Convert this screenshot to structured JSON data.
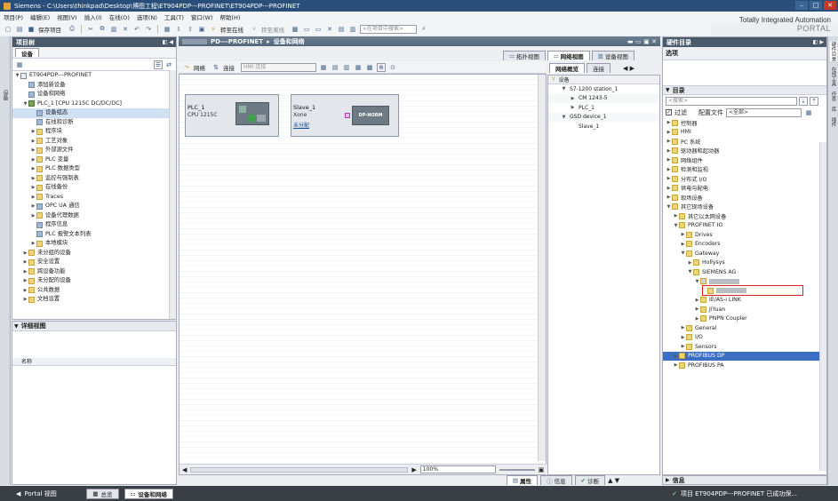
{
  "window": {
    "title": "Siemens  -  C:\\Users\\thinkpad\\Desktop\\博图工程\\ET904PDP---PROFINET\\ET904PDP---PROFINET"
  },
  "brand": {
    "line1": "Totally Integrated Automation",
    "line2": "PORTAL"
  },
  "menu": [
    "项目(P)",
    "编辑(E)",
    "视图(V)",
    "插入(I)",
    "在线(O)",
    "选项(N)",
    "工具(T)",
    "窗口(W)",
    "帮助(H)"
  ],
  "toolbar": {
    "save_label": "保存项目",
    "go_online_label": "转至在线",
    "go_offline_label": "转至离线",
    "search_placeholder": "<在项目中搜索>"
  },
  "project_tree": {
    "header": "项目树",
    "devices_tab": "设备",
    "rows": [
      {
        "indent": 0,
        "twisty": "▼",
        "icon": "doc",
        "label": "ET904PDP---PROFINET"
      },
      {
        "indent": 1,
        "twisty": "",
        "icon": "cfg",
        "label": "添加新设备"
      },
      {
        "indent": 1,
        "twisty": "",
        "icon": "cfg",
        "label": "设备和网络"
      },
      {
        "indent": 1,
        "twisty": "▼",
        "icon": "plc",
        "label": "PLC_1 [CPU 1215C DC/DC/DC]"
      },
      {
        "indent": 2,
        "twisty": "",
        "icon": "cfg",
        "label": "设备组态",
        "selected": true
      },
      {
        "indent": 2,
        "twisty": "",
        "icon": "cfg",
        "label": "在线和诊断"
      },
      {
        "indent": 2,
        "twisty": "▶",
        "icon": "folder",
        "label": "程序块"
      },
      {
        "indent": 2,
        "twisty": "▶",
        "icon": "folder",
        "label": "工艺对象"
      },
      {
        "indent": 2,
        "twisty": "▶",
        "icon": "folder",
        "label": "外部源文件"
      },
      {
        "indent": 2,
        "twisty": "▶",
        "icon": "folder",
        "label": "PLC 变量"
      },
      {
        "indent": 2,
        "twisty": "▶",
        "icon": "folder",
        "label": "PLC 数据类型"
      },
      {
        "indent": 2,
        "twisty": "▶",
        "icon": "folder",
        "label": "监控与强制表"
      },
      {
        "indent": 2,
        "twisty": "▶",
        "icon": "folder",
        "label": "在线备份"
      },
      {
        "indent": 2,
        "twisty": "▶",
        "icon": "folder",
        "label": "Traces"
      },
      {
        "indent": 2,
        "twisty": "▶",
        "icon": "cfg",
        "label": "OPC UA 通信"
      },
      {
        "indent": 2,
        "twisty": "▶",
        "icon": "folder",
        "label": "设备代理数据"
      },
      {
        "indent": 2,
        "twisty": "",
        "icon": "cfg",
        "label": "程序信息"
      },
      {
        "indent": 2,
        "twisty": "",
        "icon": "cfg",
        "label": "PLC 报警文本列表"
      },
      {
        "indent": 2,
        "twisty": "▶",
        "icon": "folder",
        "label": "本地模块"
      },
      {
        "indent": 1,
        "twisty": "▶",
        "icon": "folder",
        "label": "未分组的设备"
      },
      {
        "indent": 1,
        "twisty": "▶",
        "icon": "folder",
        "label": "安全设置"
      },
      {
        "indent": 1,
        "twisty": "▶",
        "icon": "folder",
        "label": "跨设备功能"
      },
      {
        "indent": 1,
        "twisty": "▶",
        "icon": "folder",
        "label": "未分配的设备"
      },
      {
        "indent": 1,
        "twisty": "▶",
        "icon": "folder",
        "label": "公共数据"
      },
      {
        "indent": 1,
        "twisty": "▶",
        "icon": "folder",
        "label": "文档设置"
      }
    ],
    "details_header": "详细视图",
    "details_col": "名称"
  },
  "center": {
    "breadcrumb_a": "PD---PROFINET",
    "breadcrumb_b": "设备和网络",
    "tabs": [
      "拓扑视图",
      "网络视图",
      "设备视图"
    ],
    "tool_network": "网络",
    "tool_connect": "连接",
    "hmi_dropdown": "HMI 连接",
    "devices": [
      {
        "name": "PLC_1",
        "type": "CPU 1215C",
        "link": ""
      },
      {
        "name": "Slave_1",
        "type": "Xone",
        "link": "未分配",
        "module": "DP-NORM"
      }
    ],
    "zoom": "100%"
  },
  "network_overview": {
    "tabs": [
      "网络概览",
      "连接"
    ],
    "col": "设备",
    "rows": [
      {
        "indent": 1,
        "twisty": "▼",
        "label": "S7-1200 station_1"
      },
      {
        "indent": 2,
        "twisty": "▶",
        "label": "CM 1243-5"
      },
      {
        "indent": 2,
        "twisty": "▶",
        "label": "PLC_1"
      },
      {
        "indent": 1,
        "twisty": "▼",
        "label": "GSD device_1"
      },
      {
        "indent": 2,
        "twisty": "",
        "label": "Slave_1"
      }
    ]
  },
  "hw_catalog": {
    "header": "硬件目录",
    "options": "选项",
    "catalog": "目录",
    "search_placeholder": "<搜索>",
    "filter_label": "过滤",
    "profile_label": "配置文件",
    "profile_value": "<全部>",
    "rows": [
      {
        "indent": 0,
        "twisty": "▶",
        "label": "控制器"
      },
      {
        "indent": 0,
        "twisty": "▶",
        "label": "HMI"
      },
      {
        "indent": 0,
        "twisty": "▶",
        "label": "PC 系统"
      },
      {
        "indent": 0,
        "twisty": "▶",
        "label": "驱动器和起动器"
      },
      {
        "indent": 0,
        "twisty": "▶",
        "label": "网络组件"
      },
      {
        "indent": 0,
        "twisty": "▶",
        "label": "检测和监视"
      },
      {
        "indent": 0,
        "twisty": "▶",
        "label": "分布式 I/O"
      },
      {
        "indent": 0,
        "twisty": "▶",
        "label": "供电与配电"
      },
      {
        "indent": 0,
        "twisty": "▶",
        "label": "现场设备"
      },
      {
        "indent": 0,
        "twisty": "▼",
        "label": "其它现场设备"
      },
      {
        "indent": 1,
        "twisty": "▶",
        "label": "其它以太网设备"
      },
      {
        "indent": 1,
        "twisty": "▼",
        "label": "PROFINET IO"
      },
      {
        "indent": 2,
        "twisty": "▶",
        "label": "Drives"
      },
      {
        "indent": 2,
        "twisty": "▶",
        "label": "Encoders"
      },
      {
        "indent": 2,
        "twisty": "▼",
        "label": "Gateway"
      },
      {
        "indent": 3,
        "twisty": "▶",
        "label": "Hollysys"
      },
      {
        "indent": 3,
        "twisty": "▼",
        "label": "SIEMENS AG"
      },
      {
        "indent": 4,
        "twisty": "▼",
        "label": "",
        "blurred": true
      },
      {
        "indent": 5,
        "twisty": "",
        "label": "",
        "blurred": true,
        "highlight": true
      },
      {
        "indent": 4,
        "twisty": "▶",
        "label": "IE/AS-i LINK"
      },
      {
        "indent": 4,
        "twisty": "▶",
        "label": "JiYuan"
      },
      {
        "indent": 4,
        "twisty": "▶",
        "label": "PNPN Coupler"
      },
      {
        "indent": 2,
        "twisty": "▶",
        "label": "General"
      },
      {
        "indent": 2,
        "twisty": "▶",
        "label": "I/O"
      },
      {
        "indent": 2,
        "twisty": "▶",
        "label": "Sensors"
      },
      {
        "indent": 1,
        "twisty": "▶",
        "label": "PROFIBUS DP",
        "selected": true
      },
      {
        "indent": 1,
        "twisty": "▶",
        "label": "PROFIBUS PA"
      }
    ],
    "info": "信息",
    "side_tabs": [
      "硬件目录",
      "在线工具",
      "任务",
      "库",
      "插件"
    ]
  },
  "inspector": {
    "properties": "属性",
    "info": "信息",
    "diagnostics": "诊断"
  },
  "portal": {
    "portal_view": "Portal 视图",
    "tab_overview": "总览",
    "tab_devices": "设备和网络",
    "status": "项目 ET904PDP---PROFINET 已成功保..."
  },
  "left_side_tab": "设备",
  "colors": {
    "accent": "#2a4e7a",
    "highlight": "#e0221f",
    "selection": "#cfe0f3"
  }
}
